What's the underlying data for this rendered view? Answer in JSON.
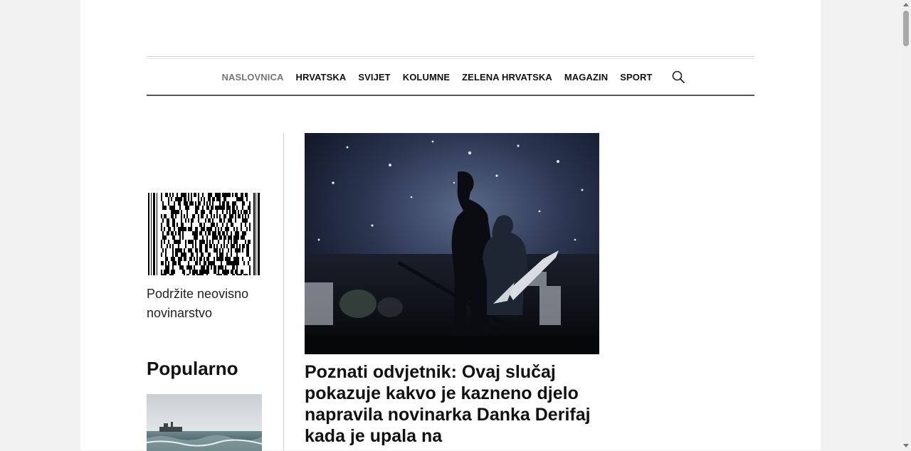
{
  "nav": {
    "items": [
      {
        "label": "NASLOVNICA",
        "active": true
      },
      {
        "label": "HRVATSKA",
        "active": false
      },
      {
        "label": "SVIJET",
        "active": false
      },
      {
        "label": "KOLUMNE",
        "active": false
      },
      {
        "label": "ZELENA HRVATSKA",
        "active": false
      },
      {
        "label": "MAGAZIN",
        "active": false
      },
      {
        "label": "SPORT",
        "active": false
      }
    ],
    "search_icon": "search-icon"
  },
  "sidebar": {
    "support_text": "Podržite neovisno novinarstvo",
    "popular_title": "Popularno"
  },
  "article": {
    "headline": "Poznati odvjetnik: Ovaj slučaj pokazuje kakvo je kazneno djelo napravila novinarka Danka Derifaj kada je upala na"
  },
  "colors": {
    "nav_active": "#777777",
    "nav_text": "#111111",
    "page_bg": "#f2f2f2"
  }
}
